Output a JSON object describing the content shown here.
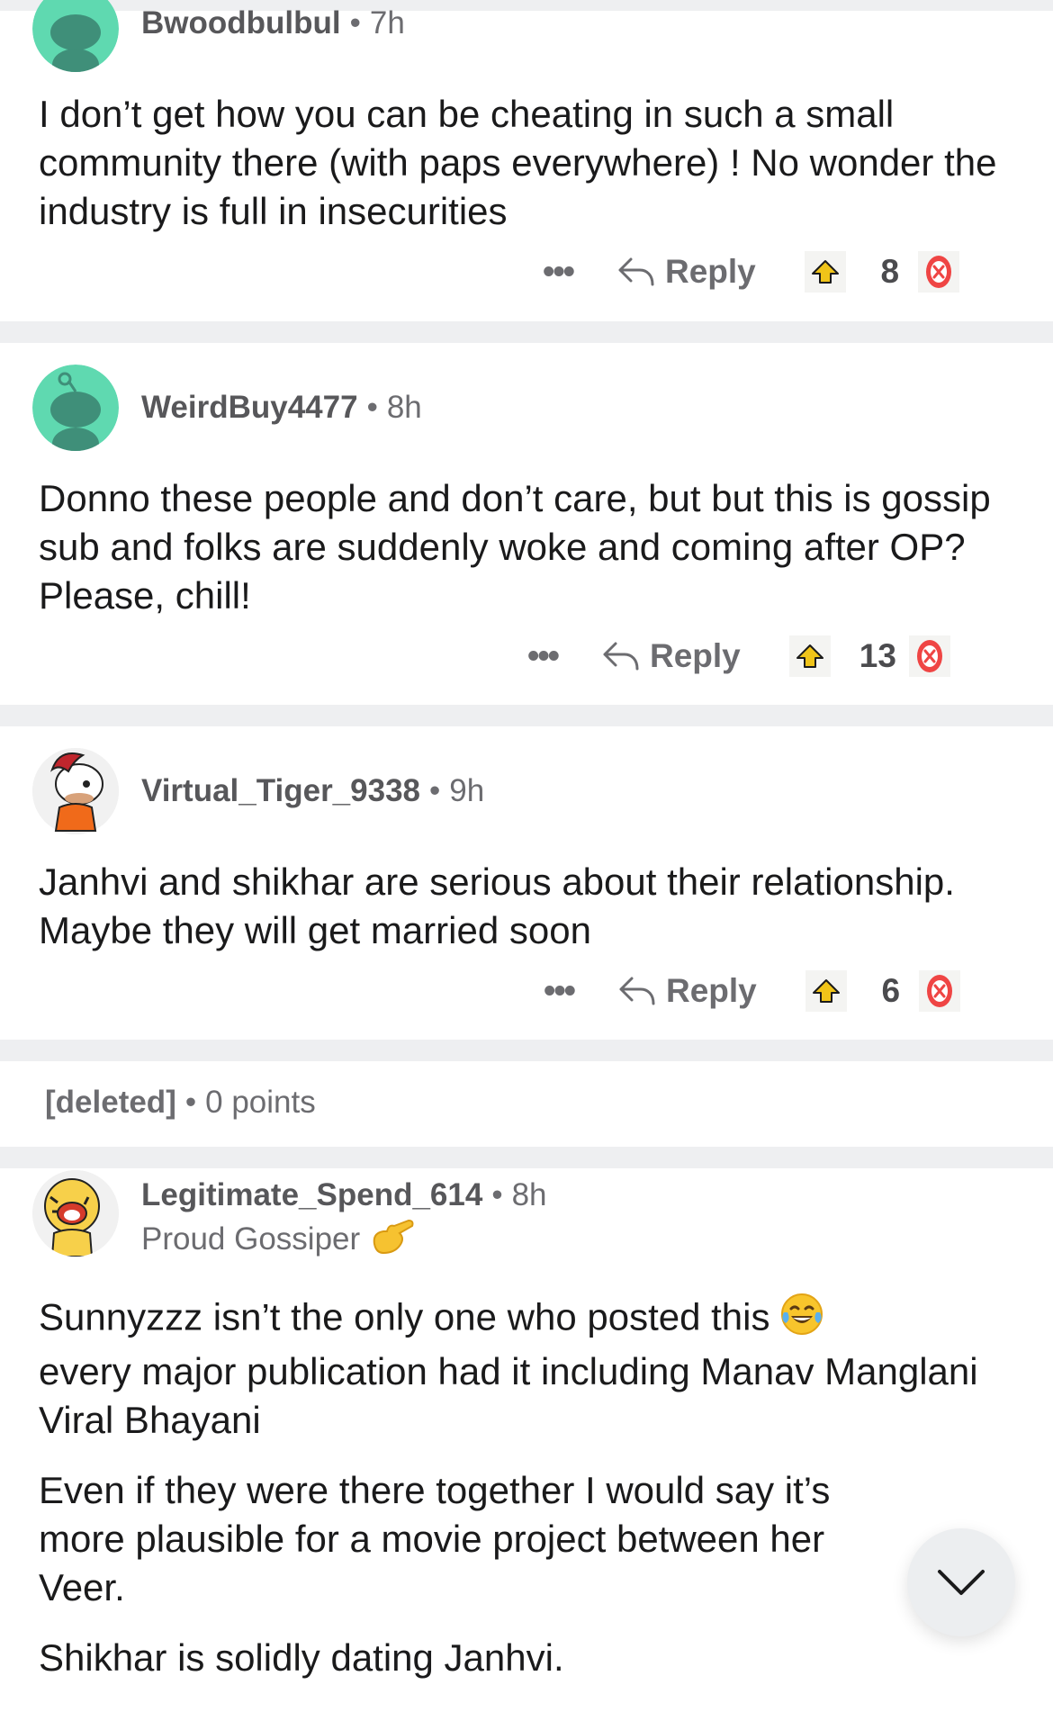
{
  "comments": [
    {
      "username": "Bwoodbulbul",
      "separator": "•",
      "age": "7h",
      "body": "I don’t get how you can be cheating in such a small community there (with paps everywhere) ! No wonder the industry is full in insecurities",
      "score": "8",
      "avatar_icon": "snoo-avatar-icon"
    },
    {
      "username": "WeirdBuy4477",
      "separator": "•",
      "age": "8h",
      "body": "Donno these people and don’t care, but but this is gossip sub and folks are suddenly woke and coming after OP? Please, chill!",
      "score": "13",
      "avatar_icon": "snoo-avatar-icon"
    },
    {
      "username": "Virtual_Tiger_9338",
      "separator": "•",
      "age": "9h",
      "body": "Janhvi and shikhar are serious about their relationship. Maybe they will get married soon",
      "score": "6",
      "avatar_icon": "custom-snoo-avatar-icon"
    }
  ],
  "deleted": {
    "user": "[deleted]",
    "separator": "•",
    "points": "0 points"
  },
  "last_comment": {
    "username": "Legitimate_Spend_614",
    "separator": "•",
    "age": "8h",
    "flair": "Proud Gossiper",
    "flair_emoji": "call-me-hand-emoji",
    "paragraphs": [
      "Sunnyzzz isn’t the only one who posted this",
      "every major publication had it including Manav Manglani Viral Bhayani",
      "Even if they were there together I would say it’s more plausible for a movie project between her Veer.",
      "Shikhar is solidly dating Janhvi."
    ],
    "inline_emoji": "tears-of-joy-emoji",
    "avatar_icon": "tiger-snoo-avatar-icon"
  },
  "actions": {
    "more_icon": "ellipsis-icon",
    "more_label": "•••",
    "reply_icon": "reply-arrow-icon",
    "reply_label": "Reply",
    "upvote_icon": "upvote-arrow-icon",
    "downvote_icon": "downvote-x-icon"
  },
  "scroll_button_icon": "chevron-down-icon",
  "colors": {
    "separator": "#eeeff1",
    "snoo_mint": "#5fd9b0",
    "upvote": "#f0c419",
    "downvote": "#ef4544",
    "muted_text": "#6c6c70"
  }
}
